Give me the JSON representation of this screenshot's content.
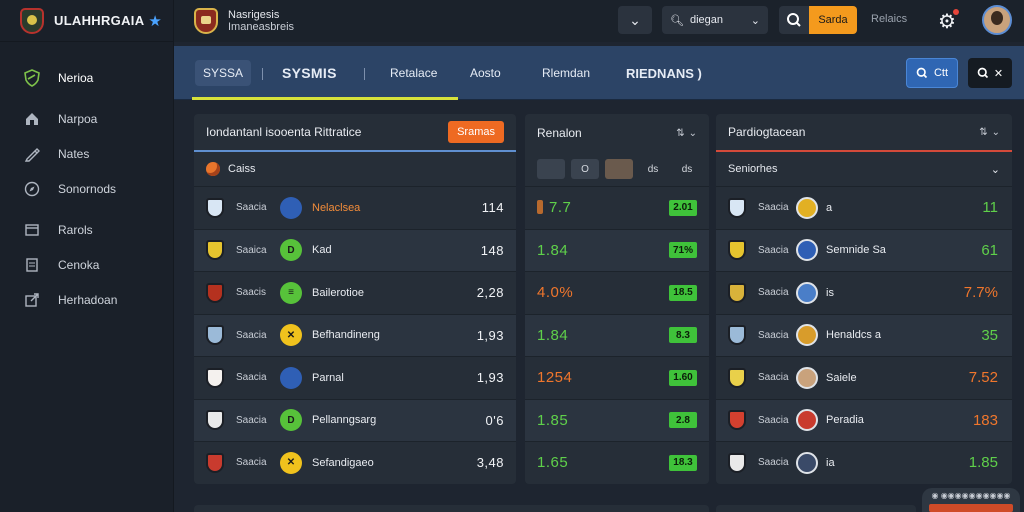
{
  "brand": {
    "name": "ULAHHRGAIA",
    "logo_icon": "shield-icon",
    "star_icon": "star-icon",
    "star_color": "#4aa3ff"
  },
  "sidebar": {
    "items": [
      {
        "label": "Nerioa",
        "icon": "shield-icon",
        "active": true
      },
      {
        "label": "Narpoa",
        "icon": "home-icon"
      },
      {
        "label": "Nates",
        "icon": "pen-icon"
      },
      {
        "label": "Sonornods",
        "icon": "compass-icon"
      },
      {
        "label": "Rarols",
        "icon": "card-icon"
      },
      {
        "label": "Cenoka",
        "icon": "document-icon"
      },
      {
        "label": "Herhadoan",
        "icon": "export-icon"
      }
    ]
  },
  "topbar": {
    "club_title": "Nasrigesis",
    "club_subtitle": "Imaneasbreis",
    "search_value": "diegan",
    "search_go": "Sarda",
    "link": "Relaics"
  },
  "tabs": [
    {
      "label": "SYSSA"
    },
    {
      "label": "SYSMIS"
    },
    {
      "label": "Retalace"
    },
    {
      "label": "Aosto"
    },
    {
      "label": "Rlemdan"
    },
    {
      "label": "RIEDNANS )"
    }
  ],
  "actions": {
    "view_label": "Ctt",
    "close_label": ""
  },
  "panel1": {
    "title": "Iondantanl isooenta Rittratice",
    "button": "Sramas",
    "sub_label": "Caiss",
    "rows": [
      {
        "abbr": "Saacia",
        "name": "Nelaclsea",
        "value": "114",
        "crest": "#d8e6f4",
        "circle": "#2f5fb5",
        "circle_text": "",
        "highlight": true
      },
      {
        "abbr": "Saaica",
        "name": "Kad",
        "value": "148",
        "crest": "#e6c42e",
        "circle": "#57c23a",
        "circle_text": "D",
        "highlight": false
      },
      {
        "abbr": "Saacis",
        "name": "Bailerotioe",
        "value": "2,28",
        "crest": "#b5311f",
        "circle": "#57c23a",
        "circle_text": "≡",
        "highlight": false
      },
      {
        "abbr": "Saacia",
        "name": "Befhandineng",
        "value": "1,93",
        "crest": "#9bbad8",
        "circle": "#f0c21d",
        "circle_text": "✕",
        "highlight": false
      },
      {
        "abbr": "Saacia",
        "name": "Parnal",
        "value": "1,93",
        "crest": "#f4f1ee",
        "circle": "#2f5fb5",
        "circle_text": "",
        "highlight": false
      },
      {
        "abbr": "Saacia",
        "name": "Pellanngsarg",
        "value": "0'6",
        "crest": "#e9e9e9",
        "circle": "#57c23a",
        "circle_text": "D",
        "highlight": false
      },
      {
        "abbr": "Saacia",
        "name": "Sefandigaeo",
        "value": "3,48",
        "crest": "#c93b2e",
        "circle": "#f0c21d",
        "circle_text": "✕",
        "highlight": false
      }
    ]
  },
  "panel2": {
    "title": "Renalon",
    "chips": [
      "",
      "O",
      "",
      "ds",
      "ds"
    ],
    "rows": [
      {
        "odd": "7.7",
        "color": "green",
        "badge": "2.01",
        "bottle": true
      },
      {
        "odd": "1.84",
        "color": "green",
        "badge": "71%",
        "bottle": false
      },
      {
        "odd": "4.0%",
        "color": "orange",
        "badge": "18.5",
        "bottle": false
      },
      {
        "odd": "1.84",
        "color": "green",
        "badge": "8.3",
        "bottle": false
      },
      {
        "odd": "1254",
        "color": "orange",
        "badge": "1.60",
        "bottle": false
      },
      {
        "odd": "1.85",
        "color": "green",
        "badge": "2.8",
        "bottle": false
      },
      {
        "odd": "1.65",
        "color": "green",
        "badge": "18.3",
        "bottle": false
      }
    ]
  },
  "panel3": {
    "title": "Pardiogtacean",
    "sub_label": "Seniorhes",
    "rows": [
      {
        "abbr": "Saacia",
        "name": "a",
        "value": "11",
        "color": "green",
        "crest": "#d8e6f4",
        "circle": "#e2b023"
      },
      {
        "abbr": "Saacia",
        "name": "Semnide Sa",
        "value": "61",
        "color": "green",
        "crest": "#e6c42e",
        "circle": "#2f5fb5"
      },
      {
        "abbr": "Saacia",
        "name": "is",
        "value": "7.7%",
        "color": "orange",
        "crest": "#d8b23a",
        "circle": "#4a7ec8"
      },
      {
        "abbr": "Saacia",
        "name": "Henaldcs a",
        "value": "35",
        "color": "green",
        "crest": "#9bbad8",
        "circle": "#d89c2b"
      },
      {
        "abbr": "Saacia",
        "name": "Saiele",
        "value": "7.52",
        "color": "orange",
        "crest": "#e9d04a",
        "circle": "#c9a27c"
      },
      {
        "abbr": "Saacia",
        "name": "Peradia",
        "value": "183",
        "color": "orange",
        "crest": "#d4402f",
        "circle": "#c93b2e"
      },
      {
        "abbr": "Saacia",
        "name": "ia",
        "value": "1.85",
        "color": "green",
        "crest": "#e9e9e9",
        "circle": "#3a4a68"
      }
    ]
  },
  "tray": {
    "label": "◉ ◉◉◉◉◉◉◉◉◉◉"
  },
  "colors": {
    "accent_green": "#5fd04a",
    "accent_orange": "#f0762c",
    "tab_bar": "#2c4466",
    "underline": "#d7e23b"
  }
}
